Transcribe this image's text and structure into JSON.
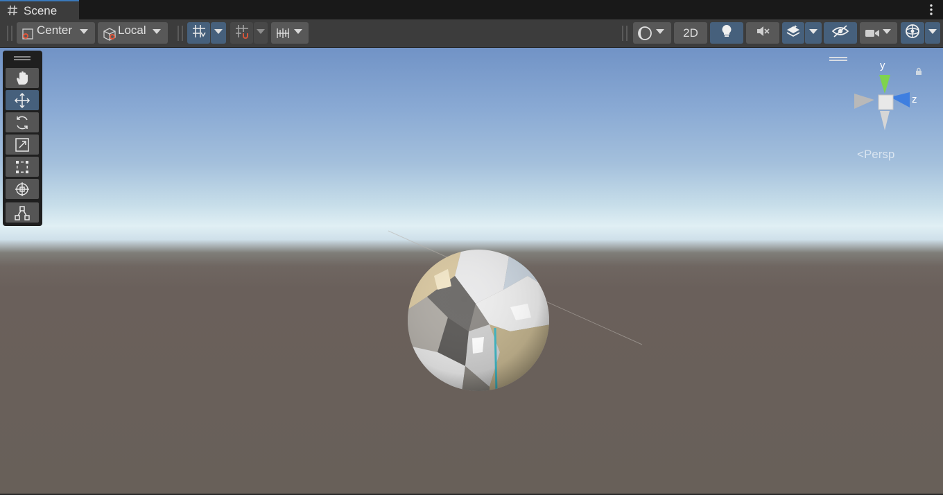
{
  "window": {
    "tab_label": "Scene"
  },
  "toolbar": {
    "pivot_mode": "Center",
    "pivot_rotation": "Local",
    "toggle_2d": "2D"
  },
  "gizmo": {
    "axis_y": "y",
    "axis_z": "z",
    "projection": "Persp"
  },
  "tools": [
    "hand-tool",
    "move-tool",
    "rotate-tool",
    "scale-tool",
    "rect-tool",
    "transform-tool",
    "custom-editor-tool"
  ],
  "icons": {
    "tab": "scene-grid-icon",
    "menu": "more-vertical-icon",
    "draw_mode": "shading-mode-icon",
    "lighting": "lightbulb-icon",
    "audio": "audio-mute-icon",
    "effects": "effects-layers-icon",
    "hidden": "scene-visibility-icon",
    "camera": "camera-icon",
    "gizmos": "gizmos-icon"
  },
  "colors": {
    "accent": "#46607c",
    "tab_highlight": "#3a79bb",
    "y_axis": "#7fd34e",
    "z_axis": "#3f7fe0"
  }
}
